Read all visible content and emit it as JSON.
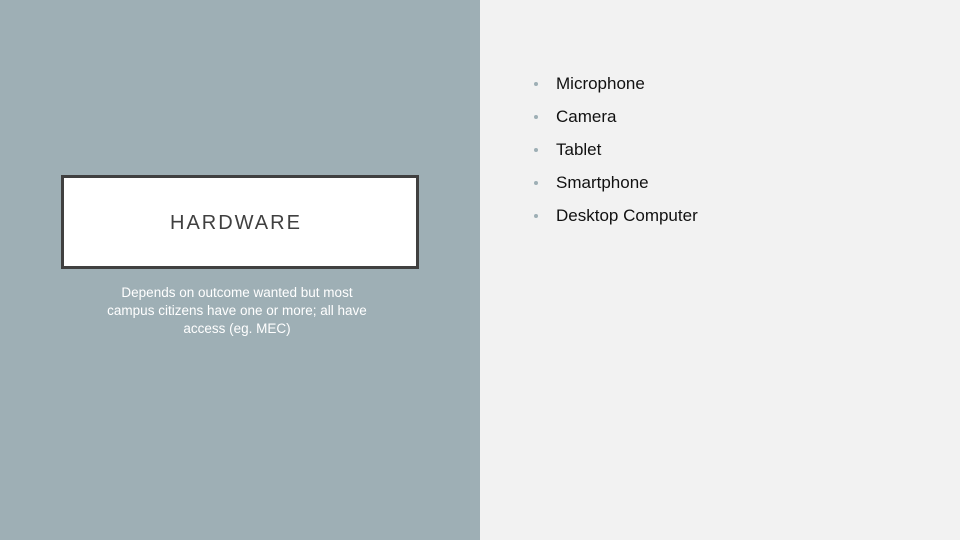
{
  "slide": {
    "title": "HARDWARE",
    "subtitle": "Depends on outcome wanted but most campus citizens have one or more; all have access (eg. MEC)",
    "bullets": [
      "Microphone",
      "Camera",
      "Tablet",
      "Smartphone",
      "Desktop Computer"
    ]
  },
  "colors": {
    "left_panel": "#9eafb5",
    "right_panel": "#f2f2f2",
    "title_box_border": "#404040",
    "bullet_marker": "#9eafb5"
  },
  "icons": {
    "bullet_marker": "bullet-dot-icon"
  }
}
